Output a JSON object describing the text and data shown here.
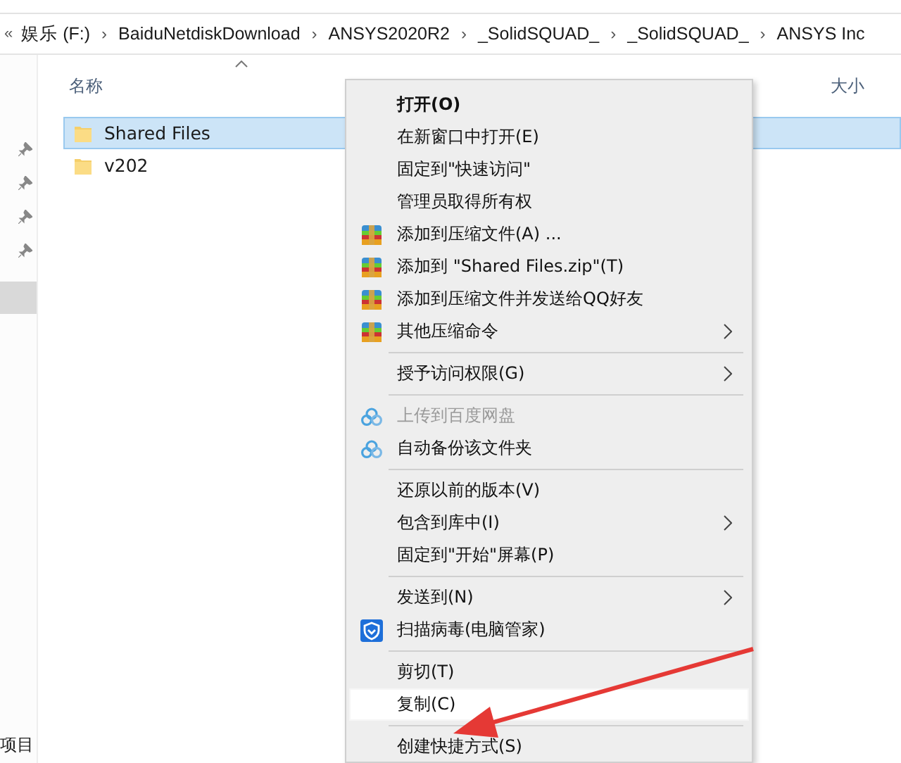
{
  "breadcrumb": {
    "back": "«",
    "separator": "›",
    "items": [
      "娱乐 (F:)",
      "BaiduNetdiskDownload",
      "ANSYS2020R2",
      "_SolidSQUAD_",
      "_SolidSQUAD_",
      "ANSYS Inc"
    ]
  },
  "columns": [
    {
      "label": "名称",
      "sorted": true
    },
    {
      "label": "大小",
      "sorted": false
    }
  ],
  "files": [
    {
      "name": "Shared Files",
      "selected": true
    },
    {
      "name": "v202",
      "selected": false
    }
  ],
  "status_bar": "项目",
  "context_menu": {
    "groups": [
      [
        {
          "label": "打开(O)",
          "bold": true,
          "kind": "plain",
          "submenu": false,
          "disabled": false,
          "selected": false
        },
        {
          "label": "在新窗口中打开(E)",
          "bold": false,
          "kind": "plain",
          "submenu": false,
          "disabled": false,
          "selected": false
        },
        {
          "label": "固定到\"快速访问\"",
          "bold": false,
          "kind": "plain",
          "submenu": false,
          "disabled": false,
          "selected": false
        },
        {
          "label": "管理员取得所有权",
          "bold": false,
          "kind": "plain",
          "submenu": false,
          "disabled": false,
          "selected": false
        },
        {
          "label": "添加到压缩文件(A) ...",
          "bold": false,
          "kind": "archive",
          "submenu": false,
          "disabled": false,
          "selected": false
        },
        {
          "label": "添加到 \"Shared Files.zip\"(T)",
          "bold": false,
          "kind": "archive",
          "submenu": false,
          "disabled": false,
          "selected": false
        },
        {
          "label": "添加到压缩文件并发送给QQ好友",
          "bold": false,
          "kind": "archive",
          "submenu": false,
          "disabled": false,
          "selected": false
        },
        {
          "label": "其他压缩命令",
          "bold": false,
          "kind": "archive",
          "submenu": true,
          "disabled": false,
          "selected": false
        }
      ],
      [
        {
          "label": "授予访问权限(G)",
          "bold": false,
          "kind": "plain",
          "submenu": true,
          "disabled": false,
          "selected": false
        }
      ],
      [
        {
          "label": "上传到百度网盘",
          "bold": false,
          "kind": "cloud",
          "submenu": false,
          "disabled": true,
          "selected": false
        },
        {
          "label": "自动备份该文件夹",
          "bold": false,
          "kind": "cloud",
          "submenu": false,
          "disabled": false,
          "selected": false
        }
      ],
      [
        {
          "label": "还原以前的版本(V)",
          "bold": false,
          "kind": "plain",
          "submenu": false,
          "disabled": false,
          "selected": false
        },
        {
          "label": "包含到库中(I)",
          "bold": false,
          "kind": "plain",
          "submenu": true,
          "disabled": false,
          "selected": false
        },
        {
          "label": "固定到\"开始\"屏幕(P)",
          "bold": false,
          "kind": "plain",
          "submenu": false,
          "disabled": false,
          "selected": false
        }
      ],
      [
        {
          "label": "发送到(N)",
          "bold": false,
          "kind": "plain",
          "submenu": true,
          "disabled": false,
          "selected": false
        },
        {
          "label": "扫描病毒(电脑管家)",
          "bold": false,
          "kind": "shield",
          "submenu": false,
          "disabled": false,
          "selected": false
        }
      ],
      [
        {
          "label": "剪切(T)",
          "bold": false,
          "kind": "plain",
          "submenu": false,
          "disabled": false,
          "selected": false
        },
        {
          "label": "复制(C)",
          "bold": false,
          "kind": "plain",
          "submenu": false,
          "disabled": false,
          "selected": true
        }
      ],
      [
        {
          "label": "创建快捷方式(S)",
          "bold": false,
          "kind": "plain",
          "submenu": false,
          "disabled": false,
          "selected": false
        }
      ]
    ]
  }
}
